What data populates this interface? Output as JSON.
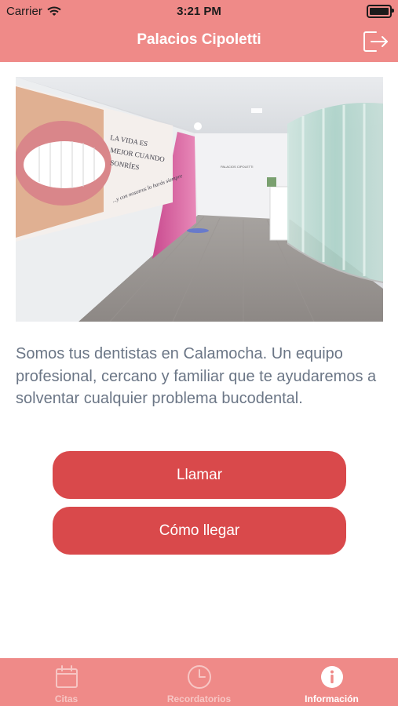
{
  "status_bar": {
    "carrier": "Carrier",
    "time": "3:21 PM",
    "wifi_icon": "wifi-icon",
    "battery_icon": "battery-icon"
  },
  "header": {
    "title": "Palacios Cipoletti",
    "logout_icon": "logout-icon",
    "background_color": "#ef8a88"
  },
  "main": {
    "image_icon": "clinic-photo",
    "image_text": {
      "wall_line1": "LA VIDA ES",
      "wall_line2": "MEJOR CUANDO",
      "wall_line3": "SONRÍES",
      "wall_script": "...y con nosotros lo harás siempre",
      "sign": "PALACIOS CIPOLETTI"
    },
    "description": "Somos tus dentistas en Calamocha. Un equipo profesional, cercano y familiar que te ayudaremos a solventar cualquier problema bucodental.",
    "buttons": {
      "call_label": "Llamar",
      "directions_label": "Cómo llegar",
      "color": "#d9494b"
    }
  },
  "tabbar": {
    "tabs": [
      {
        "label": "Citas",
        "icon": "calendar-icon",
        "active": false
      },
      {
        "label": "Recordatorios",
        "icon": "clock-icon",
        "active": false
      },
      {
        "label": "Información",
        "icon": "info-icon",
        "active": true
      }
    ]
  }
}
